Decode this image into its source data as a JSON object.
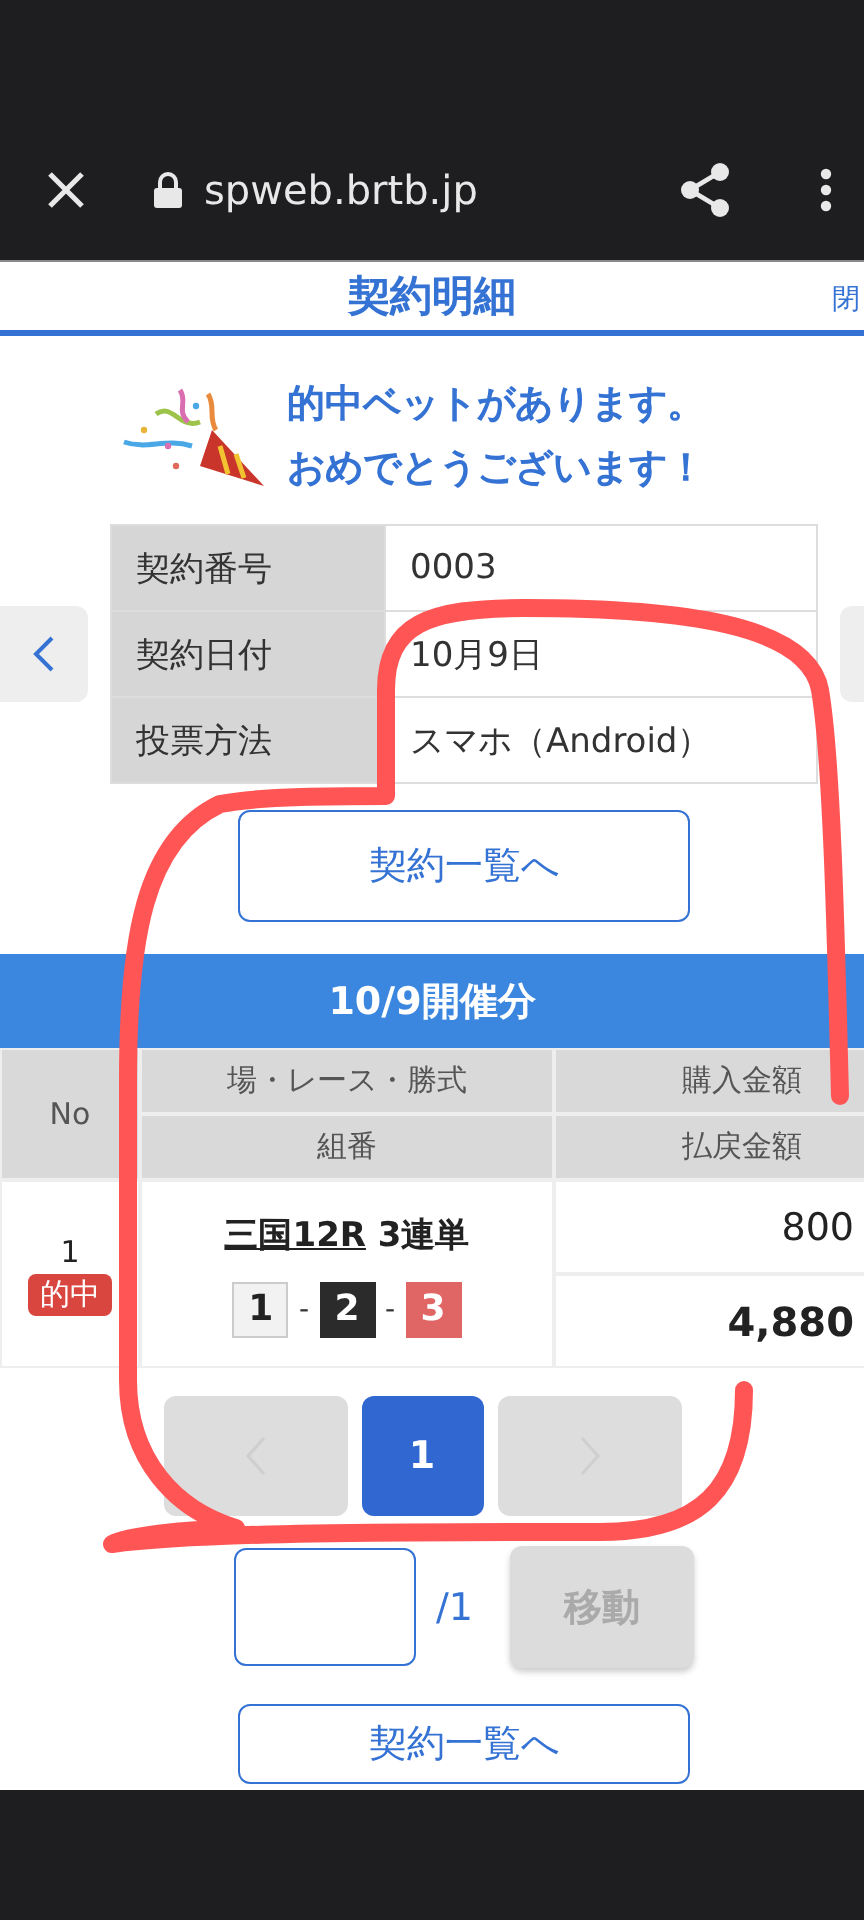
{
  "browser": {
    "url": "spweb.brtb.jp"
  },
  "header": {
    "title": "契約明細",
    "corner_link": "閉"
  },
  "message": [
    "的中ベットがあります。",
    "おめでとうございます！"
  ],
  "details": [
    {
      "label": "契約番号",
      "value": "0003"
    },
    {
      "label": "契約日付",
      "value": "10月9日"
    },
    {
      "label": "投票方法",
      "value": "スマホ（Android）"
    }
  ],
  "list_button": "契約一覧へ",
  "section_title": "10/9開催分",
  "table": {
    "columns": {
      "no": "No",
      "race": "場・レース・勝式",
      "combo": "組番",
      "purchase": "購入金額",
      "payout": "払戻金額"
    },
    "rows": [
      {
        "no": "1",
        "badge": "的中",
        "race_link": "三国12R",
        "bet_type": "3連単",
        "picks": [
          {
            "number": "1",
            "color": "#f2f2f2"
          },
          {
            "number": "2",
            "color": "#2b2b2b"
          },
          {
            "number": "3",
            "color": "#e06666"
          }
        ],
        "separator": "-",
        "purchase": "800",
        "payout": "4,880"
      }
    ]
  },
  "pagination": {
    "prev_disabled": true,
    "next_disabled": true,
    "pages": [
      {
        "label": "1",
        "selected": true
      }
    ]
  },
  "jump": {
    "total": "/1",
    "button": "移動",
    "disabled": true
  },
  "bottom_button": "契約一覧へ"
}
